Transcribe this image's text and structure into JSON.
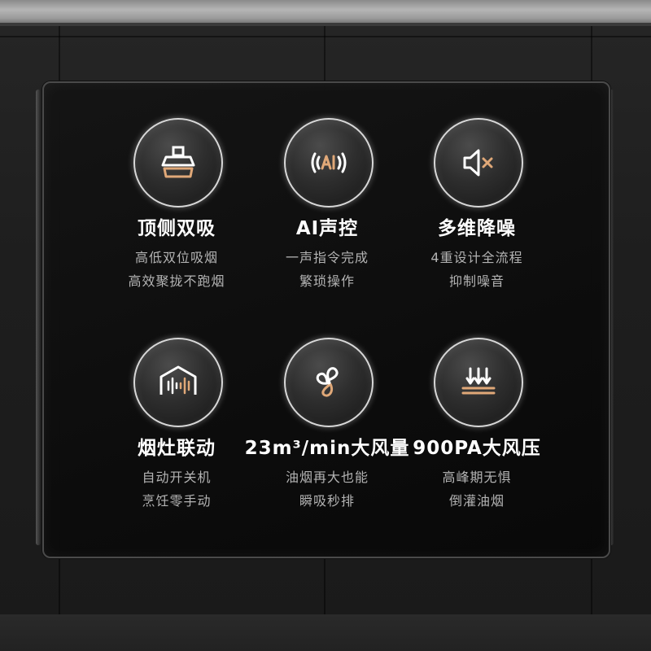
{
  "features": [
    {
      "icon": "range-hood-icon",
      "title": "顶侧双吸",
      "desc": [
        "高低双位吸烟",
        "高效聚拢不跑烟"
      ]
    },
    {
      "icon": "ai-voice-icon",
      "title": "AI声控",
      "desc": [
        "一声指令完成",
        "繁琐操作"
      ]
    },
    {
      "icon": "mute-speaker-icon",
      "title": "多维降噪",
      "desc": [
        "4重设计全流程",
        "抑制噪音"
      ]
    },
    {
      "icon": "stove-linkage-icon",
      "title": "烟灶联动",
      "desc": [
        "自动开关机",
        "烹饪零手动"
      ]
    },
    {
      "icon": "fan-blade-icon",
      "title": "23m³/min大风量",
      "desc": [
        "油烟再大也能",
        "瞬吸秒排"
      ]
    },
    {
      "icon": "air-pressure-icon",
      "title": "900PA大风压",
      "desc": [
        "高峰期无惧",
        "倒灌油烟"
      ]
    }
  ],
  "colors": {
    "accent": "#e0a878",
    "icon_white": "#ffffff",
    "title": "#ffffff",
    "desc": "#b3b3b3"
  }
}
